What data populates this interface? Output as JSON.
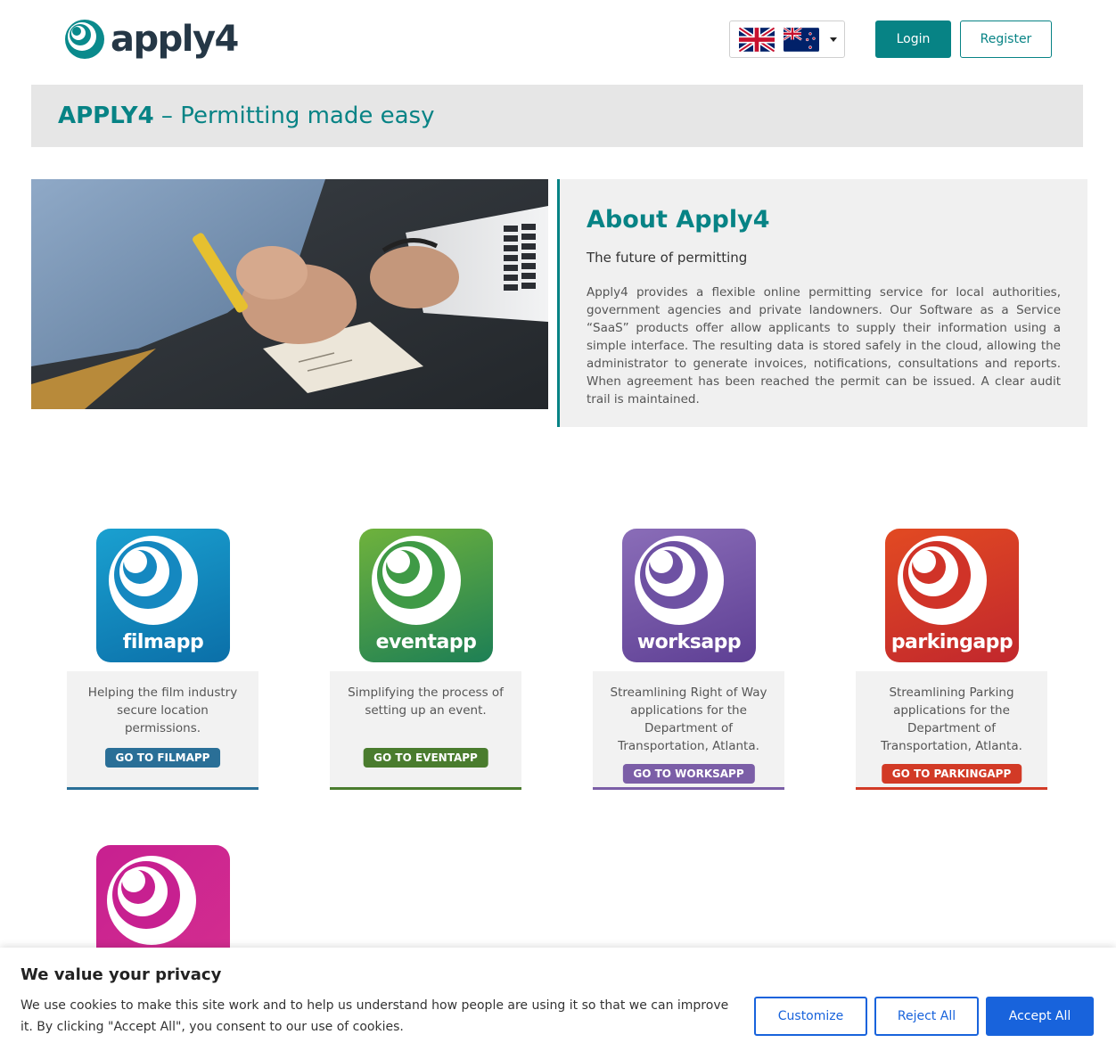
{
  "header": {
    "logo_text": "apply4",
    "flags": [
      "uk-flag-icon",
      "nz-flag-icon"
    ],
    "login_label": "Login",
    "register_label": "Register"
  },
  "banner": {
    "brand": "APPLY4",
    "tagline": " – Permitting made easy"
  },
  "about": {
    "title": "About Apply4",
    "subtitle": "The future of permitting",
    "body": "Apply4 provides a flexible online permitting service for local authorities, government agencies and private landowners. Our Software as a Service “SaaS” products offer allow applicants to supply their information using a simple interface. The resulting data is stored safely in the cloud, allowing the administrator to generate invoices, notifications, consultations and reports. When agreement has been reached the permit can be issued. A clear audit trail is maintained."
  },
  "apps": [
    {
      "icon_label": "filmapp",
      "description": "Helping the film industry secure location permissions.",
      "button": "GO TO FILMAPP",
      "color": "#2a6f97"
    },
    {
      "icon_label": "eventapp",
      "description": "Simplifying the process of setting up an event.",
      "button": "GO TO EVENTAPP",
      "color": "#4a7c2e"
    },
    {
      "icon_label": "worksapp",
      "description": "Streamlining Right of Way applications for the Department of Transportation, Atlanta.",
      "button": "GO TO WORKSAPP",
      "color": "#7b5ea7"
    },
    {
      "icon_label": "parkingapp",
      "description": "Streamlining Parking applications for the Department of Transportation, Atlanta.",
      "button": "GO TO PARKINGAPP",
      "color": "#d23a26"
    }
  ],
  "cookie": {
    "title": "We value your privacy",
    "text": "We use cookies to make this site work and to help us understand how people are using it so that we can improve it. By clicking \"Accept All\", you consent to our use of cookies.",
    "customize": "Customize",
    "reject": "Reject All",
    "accept": "Accept All"
  },
  "colors": {
    "accent": "#078385",
    "cookie_blue": "#1863dc"
  }
}
